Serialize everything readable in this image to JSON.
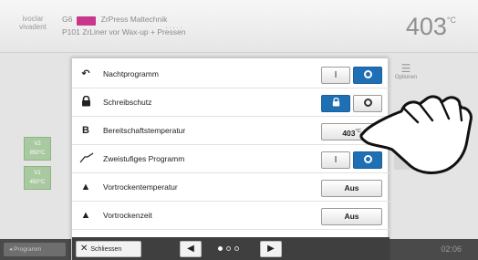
{
  "header": {
    "logo_line1": "ivoclar",
    "logo_line2": "vivadent",
    "program_code": "G6",
    "program_badge": "",
    "program_title": "ZrPress Maltechnik",
    "program_number": "P101",
    "program_subtitle": "ZrLiner vor Wax-up + Pressen",
    "temperature_value": "403",
    "temperature_unit": "°C"
  },
  "background": {
    "chip1_line1": "V2",
    "chip1_line2": "850°C",
    "chip2_line1": "V1",
    "chip2_line2": "450°C",
    "options_label": "Optionen",
    "program_button": "Programm",
    "time": "02:06"
  },
  "dialog": {
    "rows": [
      {
        "label": "Nachtprogramm",
        "icon": "night-program-icon",
        "control": "toggle",
        "on_label": "I",
        "state": "off"
      },
      {
        "label": "Schreibschutz",
        "icon": "lock-icon",
        "control": "toggle",
        "on_label": "lock",
        "state": "on"
      },
      {
        "label": "Bereitschaftstemperatur",
        "icon": "B",
        "control": "value",
        "value": "403",
        "unit": "°C"
      },
      {
        "label": "Zweistufiges Programm",
        "icon": "two-stage-icon",
        "control": "toggle",
        "on_label": "I",
        "state": "off"
      },
      {
        "label": "Vortrockentemperatur",
        "icon": "predry-temperature-icon",
        "control": "value",
        "value": "Aus"
      },
      {
        "label": "Vortrockenzeit",
        "icon": "predry-time-icon",
        "control": "value",
        "value": "Aus"
      }
    ],
    "close_label": "Schliessen",
    "page_count": 3,
    "current_page": 1
  },
  "colors": {
    "accent_blue": "#1f6fb4",
    "badge_magenta": "#c8378a",
    "footer_dark": "#3f3f3f"
  }
}
